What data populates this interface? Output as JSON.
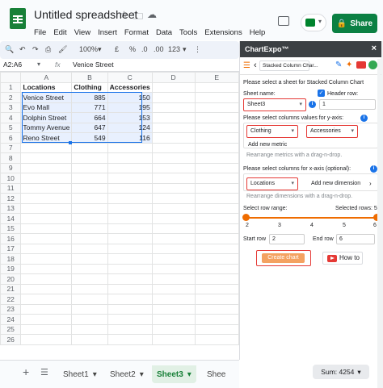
{
  "app": {
    "title": "Untitled spreadsheet",
    "menu": [
      "File",
      "Edit",
      "View",
      "Insert",
      "Format",
      "Data",
      "Tools",
      "Extensions",
      "Help"
    ],
    "share_label": "Share",
    "colors": {
      "sheets_green": "#188038",
      "share_green": "#0b8043",
      "selection_blue": "#1a73e8",
      "accent_orange": "#ef6c00",
      "highlight_red": "#e53935"
    }
  },
  "toolbar": {
    "zoom": "100%",
    "currency": "£",
    "percent": "%",
    "decimal_less": ".0",
    "decimal_more": ".00",
    "number_format": "123"
  },
  "formula_bar": {
    "name_box": "A2:A6",
    "fx": "fx",
    "value": "Venice Street"
  },
  "grid": {
    "columns": [
      "A",
      "B",
      "C",
      "D",
      "E"
    ],
    "rows": [
      {
        "n": "1",
        "cells": [
          "Locations",
          "Clothing",
          "Accessories",
          "",
          ""
        ]
      },
      {
        "n": "2",
        "cells": [
          "Venice Street",
          "885",
          "150",
          "",
          ""
        ]
      },
      {
        "n": "3",
        "cells": [
          "Evo Mall",
          "771",
          "195",
          "",
          ""
        ]
      },
      {
        "n": "4",
        "cells": [
          "Dolphin Street",
          "664",
          "153",
          "",
          ""
        ]
      },
      {
        "n": "5",
        "cells": [
          "Tommy Avenue",
          "647",
          "124",
          "",
          ""
        ]
      },
      {
        "n": "6",
        "cells": [
          "Reno Street",
          "549",
          "116",
          "",
          ""
        ]
      },
      {
        "n": "7",
        "cells": [
          "",
          "",
          "",
          "",
          ""
        ]
      },
      {
        "n": "8",
        "cells": [
          "",
          "",
          "",
          "",
          ""
        ]
      },
      {
        "n": "9",
        "cells": [
          "",
          "",
          "",
          "",
          ""
        ]
      },
      {
        "n": "10",
        "cells": [
          "",
          "",
          "",
          "",
          ""
        ]
      },
      {
        "n": "11",
        "cells": [
          "",
          "",
          "",
          "",
          ""
        ]
      },
      {
        "n": "12",
        "cells": [
          "",
          "",
          "",
          "",
          ""
        ]
      },
      {
        "n": "13",
        "cells": [
          "",
          "",
          "",
          "",
          ""
        ]
      },
      {
        "n": "14",
        "cells": [
          "",
          "",
          "",
          "",
          ""
        ]
      },
      {
        "n": "15",
        "cells": [
          "",
          "",
          "",
          "",
          ""
        ]
      },
      {
        "n": "16",
        "cells": [
          "",
          "",
          "",
          "",
          ""
        ]
      },
      {
        "n": "17",
        "cells": [
          "",
          "",
          "",
          "",
          ""
        ]
      },
      {
        "n": "18",
        "cells": [
          "",
          "",
          "",
          "",
          ""
        ]
      },
      {
        "n": "19",
        "cells": [
          "",
          "",
          "",
          "",
          ""
        ]
      },
      {
        "n": "20",
        "cells": [
          "",
          "",
          "",
          "",
          ""
        ]
      },
      {
        "n": "21",
        "cells": [
          "",
          "",
          "",
          "",
          ""
        ]
      },
      {
        "n": "22",
        "cells": [
          "",
          "",
          "",
          "",
          ""
        ]
      },
      {
        "n": "23",
        "cells": [
          "",
          "",
          "",
          "",
          ""
        ]
      },
      {
        "n": "24",
        "cells": [
          "",
          "",
          "",
          "",
          ""
        ]
      },
      {
        "n": "25",
        "cells": [
          "",
          "",
          "",
          "",
          ""
        ]
      },
      {
        "n": "26",
        "cells": [
          "",
          "",
          "",
          "",
          ""
        ]
      }
    ]
  },
  "sheets": {
    "add": "+",
    "tabs": [
      "Sheet1",
      "Sheet2",
      "Sheet3",
      "Shee"
    ],
    "active": "Sheet3",
    "sum": "Sum: 4254"
  },
  "panel": {
    "title": "ChartExpo™",
    "close": "×",
    "chart_name": "Stacked Column Char...",
    "select_sheet_prompt": "Please select a sheet for Stacked Column Chart",
    "sheet_name_label": "Sheet name:",
    "header_row_label": "Header row:",
    "sheet_value": "Sheet3",
    "header_row_value": "1",
    "y_axis_prompt": "Please select columns values for y-axis:",
    "y_metric_1": "Clothing",
    "y_metric_2": "Accessories",
    "add_metric": "Add new metric",
    "rearrange_metrics": "Rearrange metrics with a drag-n-drop.",
    "x_axis_prompt": "Please select columns for x-axis (optional):",
    "x_dimension": "Locations",
    "add_dimension": "Add new dimension",
    "rearrange_dimensions": "Rearrange dimensions with a drag-n-drop.",
    "row_range_label": "Select row range:",
    "selected_rows_label": "Selected rows: 5",
    "range_ticks": [
      "2",
      "3",
      "4",
      "5",
      "6"
    ],
    "range_fill": 1.0,
    "start_row_label": "Start row",
    "start_row_value": "2",
    "end_row_label": "End row",
    "end_row_value": "6",
    "create_chart": "Create chart",
    "how_to": "How to"
  }
}
